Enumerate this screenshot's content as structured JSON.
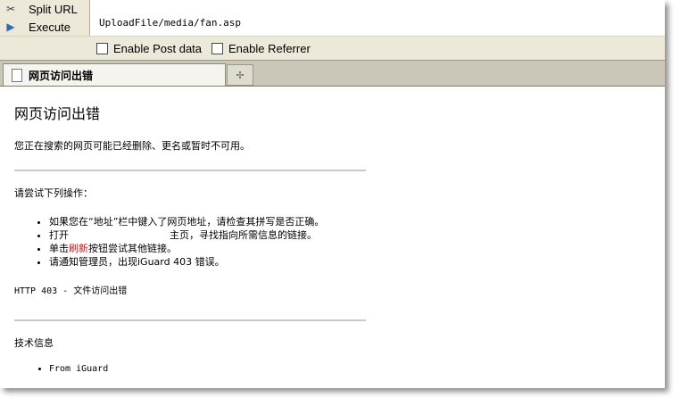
{
  "toolbar": {
    "split_url_label": "Split URL",
    "execute_label": "Execute",
    "split_icon": "scissors-icon",
    "execute_icon": "play-icon",
    "url_value": "UploadFile/media/fan.asp",
    "enable_post_label": "Enable Post data",
    "enable_referrer_label": "Enable Referrer"
  },
  "tabs": {
    "active_title": "网页访问出错",
    "new_tab_icon": "new-tab-icon"
  },
  "page": {
    "heading": "网页访问出错",
    "intro": "您正在搜索的网页可能已经删除、更名或暂时不可用。",
    "try_heading": "请尝试下列操作：",
    "items": {
      "item1": "如果您在“地址”栏中键入了网页地址，请检查其拼写是否正确。",
      "item2_prefix": "打开",
      "item2_suffix": "主页，寻找指向所需信息的链接。",
      "item3_prefix": "单击",
      "item3_link": "刷新",
      "item3_suffix": "按钮尝试其他链接。",
      "item4": "请通知管理员，出现iGuard 403 错误。"
    },
    "http_error": "HTTP 403 - 文件访问出错",
    "tech_heading": "技术信息",
    "tech_item": "From iGuard"
  }
}
